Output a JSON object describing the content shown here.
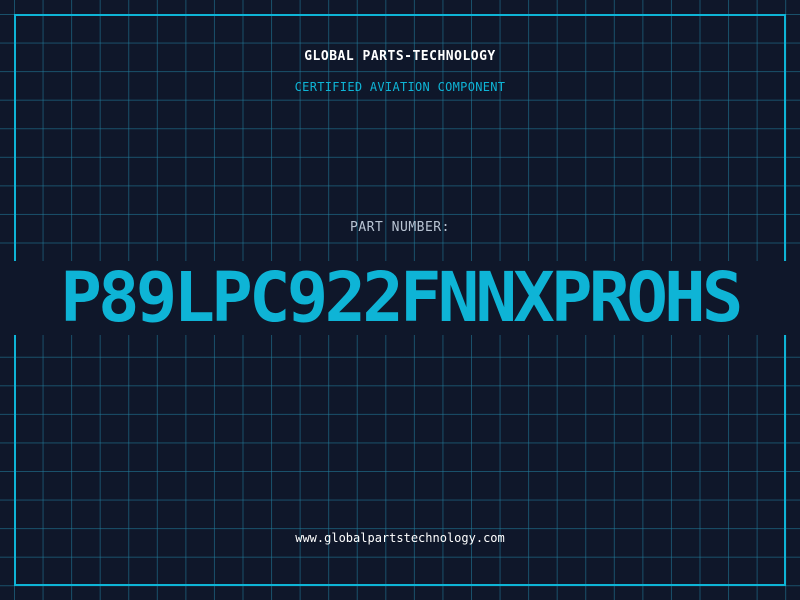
{
  "header": {
    "company": "GLOBAL PARTS-TECHNOLOGY",
    "subtitle": "CERTIFIED AVIATION COMPONENT"
  },
  "part": {
    "label": "PART NUMBER:",
    "number": "P89LPC922FNNXPROHS"
  },
  "footer": {
    "website": "www.globalpartstechnology.com"
  },
  "colors": {
    "background": "#0f172a",
    "accent": "#0eb4d6",
    "grid": "#2280a0",
    "text": "#ffffff",
    "label": "#b9c4d3"
  }
}
